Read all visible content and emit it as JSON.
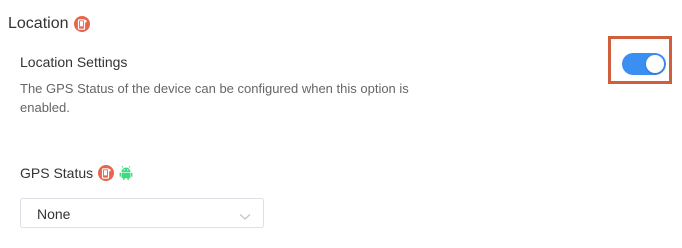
{
  "section": {
    "title": "Location",
    "icon": "ios-device-icon"
  },
  "location_setting": {
    "title": "Location Settings",
    "description": "The GPS Status of the device can be configured when this option is enabled.",
    "toggle_on": true
  },
  "gps_status": {
    "label": "GPS Status",
    "icons": [
      "ios-device-icon",
      "android-icon"
    ],
    "selected": "None"
  },
  "colors": {
    "toggle_on": "#3b8ff3",
    "highlight": "#d0603d",
    "ios_badge": "#e8644a",
    "android": "#3ddc84"
  }
}
